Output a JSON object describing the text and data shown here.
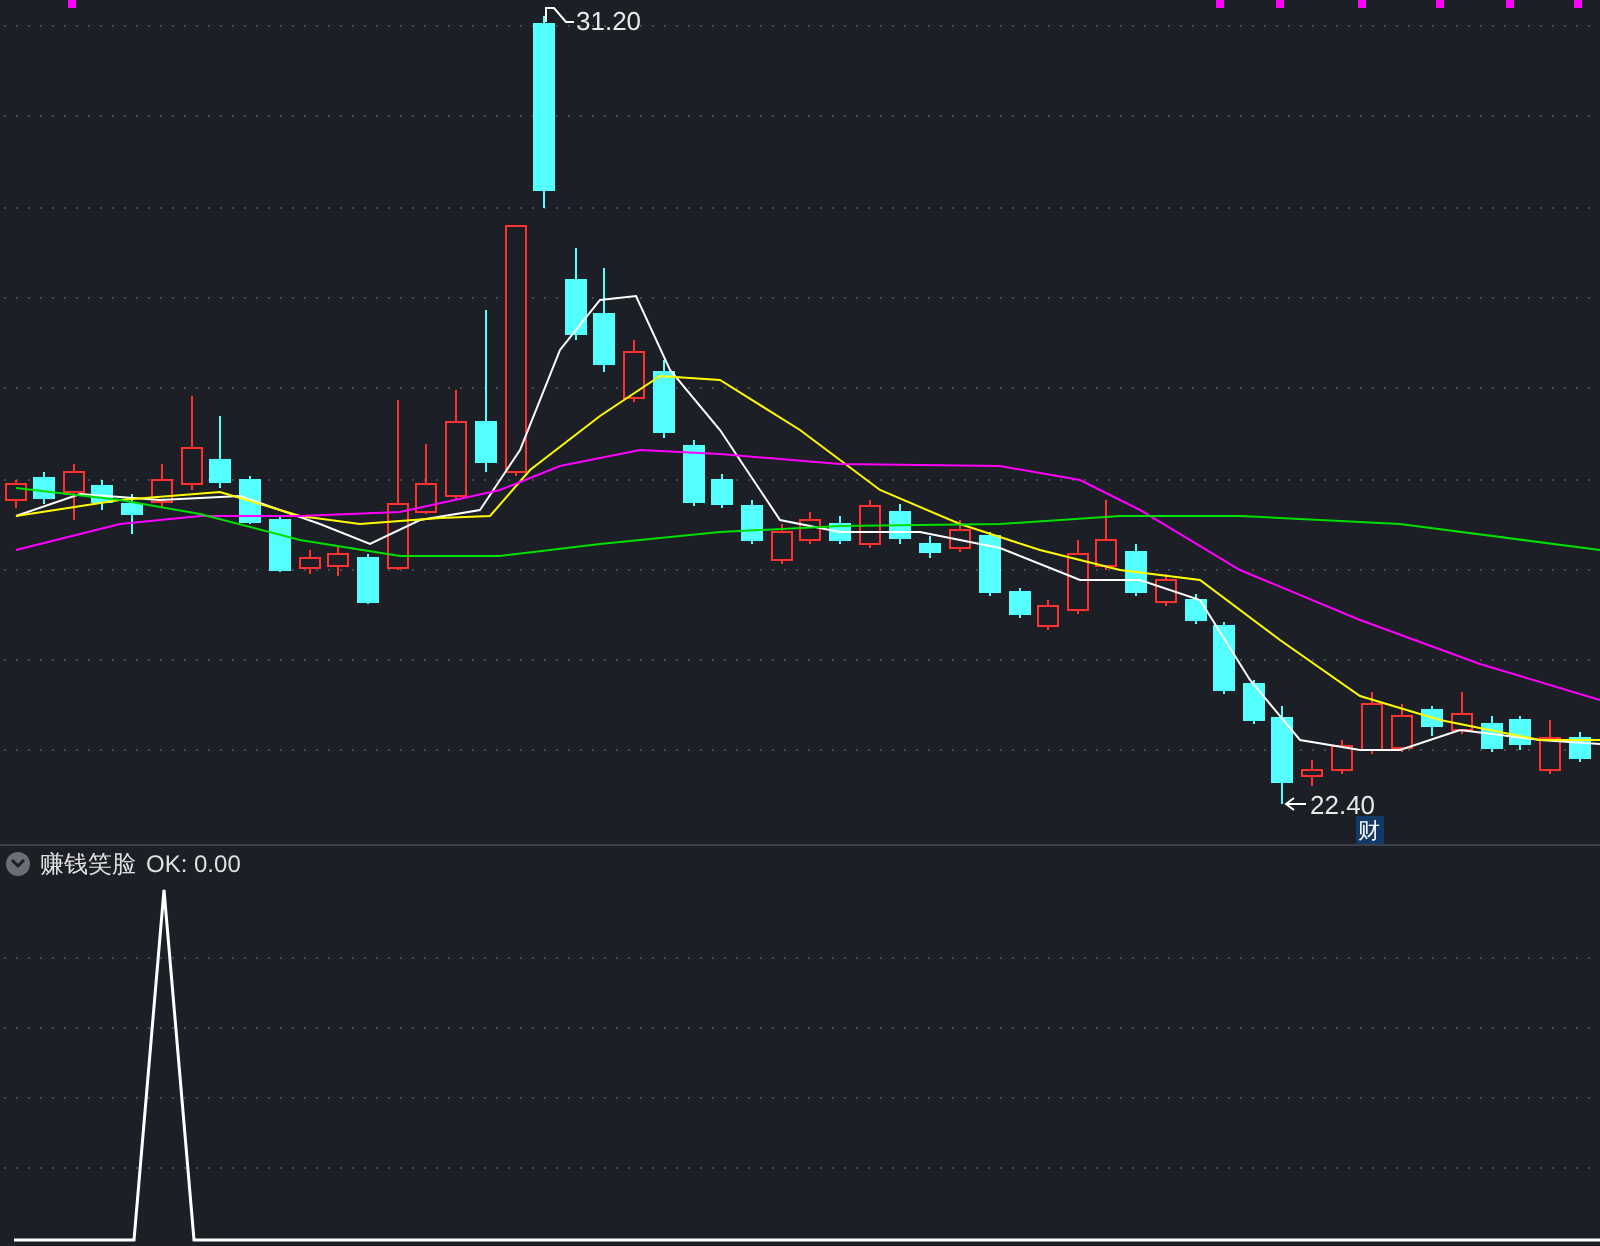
{
  "price_chart": {
    "high_label": "31.20",
    "low_label": "22.40",
    "event_tag": "财"
  },
  "indicator": {
    "name": "赚钱笑脸",
    "reading": "OK: 0.00"
  }
}
